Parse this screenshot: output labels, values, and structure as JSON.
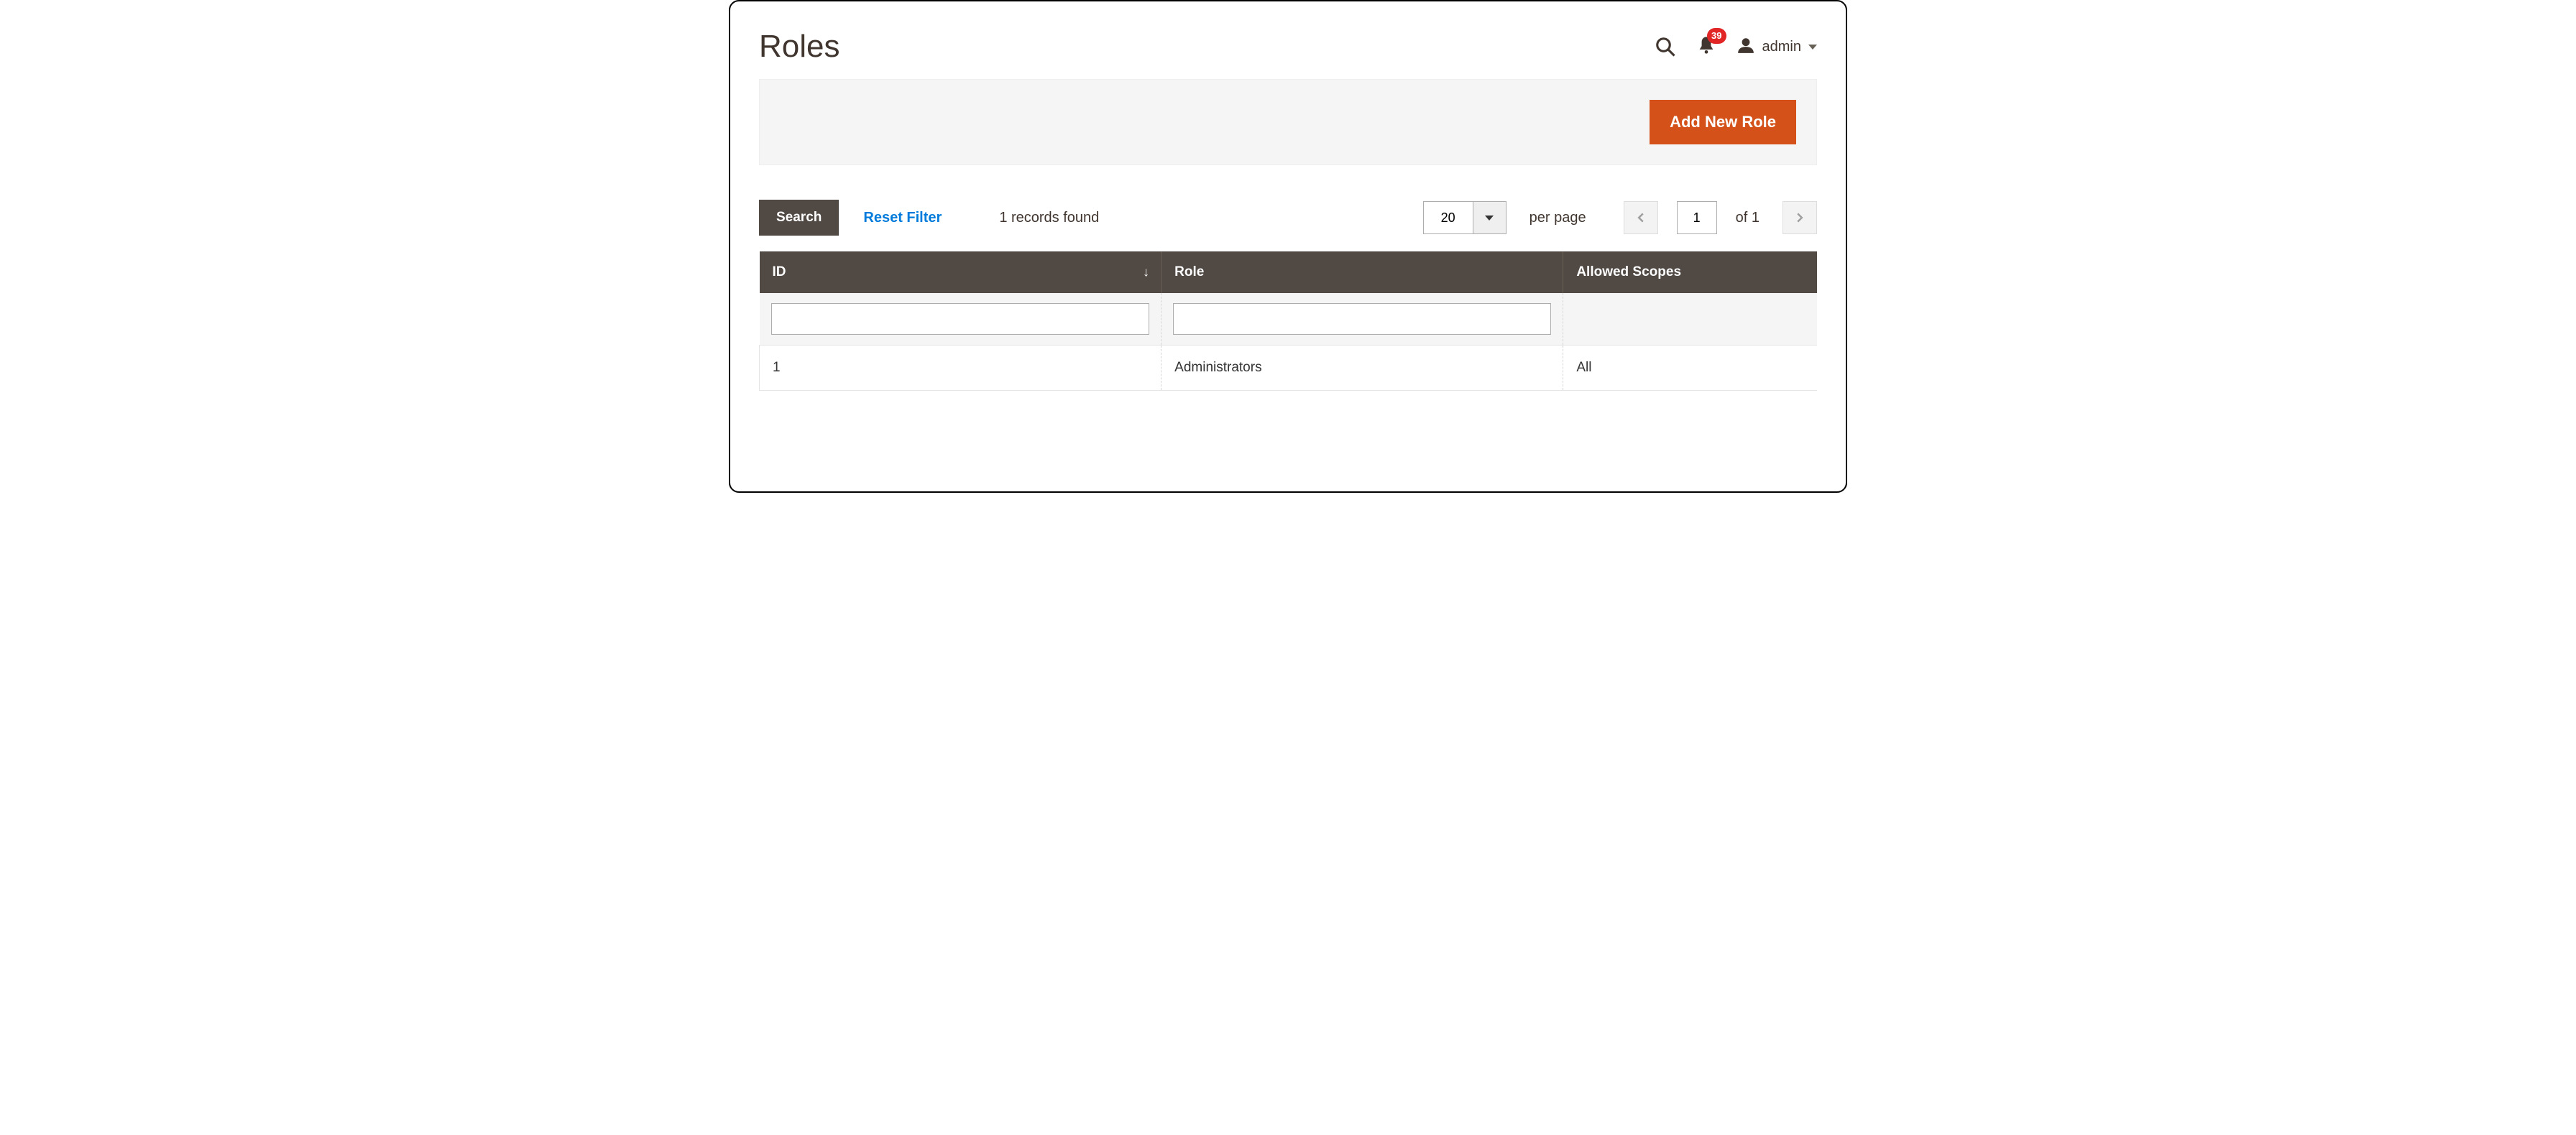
{
  "header": {
    "title": "Roles",
    "notification_count": "39",
    "user_name": "admin"
  },
  "actions": {
    "add_new_role": "Add New Role"
  },
  "toolbar": {
    "search_label": "Search",
    "reset_label": "Reset Filter",
    "records_found": "1 records found",
    "page_size": "20",
    "per_page_label": "per page",
    "current_page": "1",
    "total_pages_label": "of 1"
  },
  "table": {
    "columns": {
      "id": "ID",
      "role": "Role",
      "allowed_scopes": "Allowed Scopes"
    },
    "filters": {
      "id": "",
      "role": ""
    },
    "rows": [
      {
        "id": "1",
        "role": "Administrators",
        "allowed_scopes": "All"
      }
    ]
  }
}
